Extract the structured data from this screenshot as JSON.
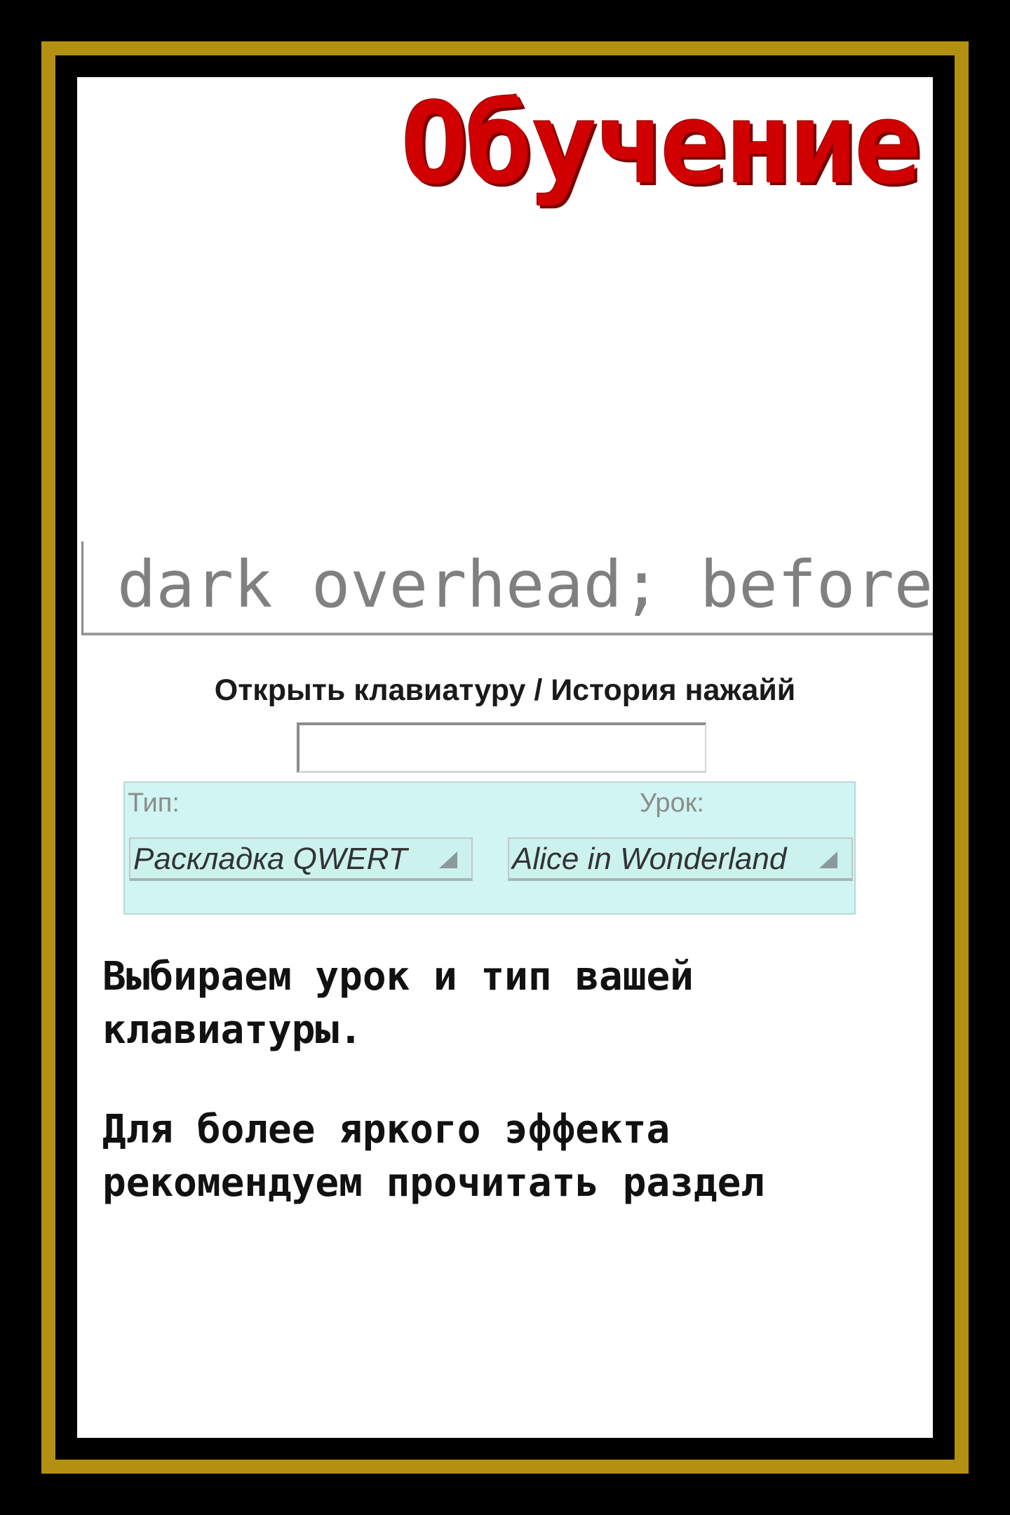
{
  "title": "Обучение",
  "typing": {
    "current_text": "dark overhead; before"
  },
  "keyboard_history_link": "Открыть клавиатуру / История нажайй",
  "history_input": {
    "value": ""
  },
  "selectors": {
    "type_label": "Тип:",
    "type_value": "Раскладка QWERT",
    "lesson_label": "Урок:",
    "lesson_value": "Alice in Wonderland"
  },
  "instructions": {
    "line1": "Выбираем урок и тип вашей клавиатуры.",
    "line2": "Для более яркого эффекта рекомендуем прочитать раздел"
  },
  "colors": {
    "frame": "#000000",
    "gold_border": "#b38f12",
    "title_red": "#d00000",
    "panel_bg": "#d0f5f2"
  }
}
